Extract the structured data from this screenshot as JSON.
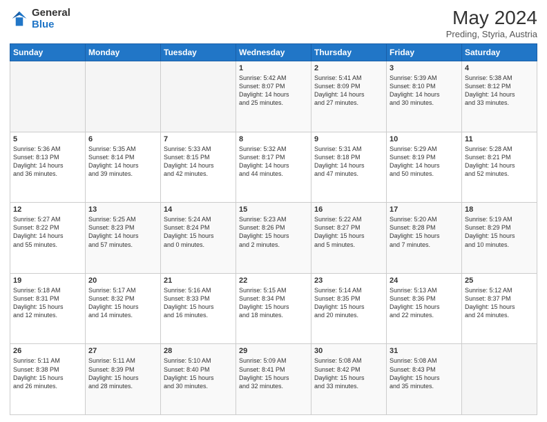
{
  "header": {
    "logo_general": "General",
    "logo_blue": "Blue",
    "month_year": "May 2024",
    "location": "Preding, Styria, Austria"
  },
  "days_of_week": [
    "Sunday",
    "Monday",
    "Tuesday",
    "Wednesday",
    "Thursday",
    "Friday",
    "Saturday"
  ],
  "weeks": [
    [
      {
        "day": "",
        "info": ""
      },
      {
        "day": "",
        "info": ""
      },
      {
        "day": "",
        "info": ""
      },
      {
        "day": "1",
        "info": "Sunrise: 5:42 AM\nSunset: 8:07 PM\nDaylight: 14 hours\nand 25 minutes."
      },
      {
        "day": "2",
        "info": "Sunrise: 5:41 AM\nSunset: 8:09 PM\nDaylight: 14 hours\nand 27 minutes."
      },
      {
        "day": "3",
        "info": "Sunrise: 5:39 AM\nSunset: 8:10 PM\nDaylight: 14 hours\nand 30 minutes."
      },
      {
        "day": "4",
        "info": "Sunrise: 5:38 AM\nSunset: 8:12 PM\nDaylight: 14 hours\nand 33 minutes."
      }
    ],
    [
      {
        "day": "5",
        "info": "Sunrise: 5:36 AM\nSunset: 8:13 PM\nDaylight: 14 hours\nand 36 minutes."
      },
      {
        "day": "6",
        "info": "Sunrise: 5:35 AM\nSunset: 8:14 PM\nDaylight: 14 hours\nand 39 minutes."
      },
      {
        "day": "7",
        "info": "Sunrise: 5:33 AM\nSunset: 8:15 PM\nDaylight: 14 hours\nand 42 minutes."
      },
      {
        "day": "8",
        "info": "Sunrise: 5:32 AM\nSunset: 8:17 PM\nDaylight: 14 hours\nand 44 minutes."
      },
      {
        "day": "9",
        "info": "Sunrise: 5:31 AM\nSunset: 8:18 PM\nDaylight: 14 hours\nand 47 minutes."
      },
      {
        "day": "10",
        "info": "Sunrise: 5:29 AM\nSunset: 8:19 PM\nDaylight: 14 hours\nand 50 minutes."
      },
      {
        "day": "11",
        "info": "Sunrise: 5:28 AM\nSunset: 8:21 PM\nDaylight: 14 hours\nand 52 minutes."
      }
    ],
    [
      {
        "day": "12",
        "info": "Sunrise: 5:27 AM\nSunset: 8:22 PM\nDaylight: 14 hours\nand 55 minutes."
      },
      {
        "day": "13",
        "info": "Sunrise: 5:25 AM\nSunset: 8:23 PM\nDaylight: 14 hours\nand 57 minutes."
      },
      {
        "day": "14",
        "info": "Sunrise: 5:24 AM\nSunset: 8:24 PM\nDaylight: 15 hours\nand 0 minutes."
      },
      {
        "day": "15",
        "info": "Sunrise: 5:23 AM\nSunset: 8:26 PM\nDaylight: 15 hours\nand 2 minutes."
      },
      {
        "day": "16",
        "info": "Sunrise: 5:22 AM\nSunset: 8:27 PM\nDaylight: 15 hours\nand 5 minutes."
      },
      {
        "day": "17",
        "info": "Sunrise: 5:20 AM\nSunset: 8:28 PM\nDaylight: 15 hours\nand 7 minutes."
      },
      {
        "day": "18",
        "info": "Sunrise: 5:19 AM\nSunset: 8:29 PM\nDaylight: 15 hours\nand 10 minutes."
      }
    ],
    [
      {
        "day": "19",
        "info": "Sunrise: 5:18 AM\nSunset: 8:31 PM\nDaylight: 15 hours\nand 12 minutes."
      },
      {
        "day": "20",
        "info": "Sunrise: 5:17 AM\nSunset: 8:32 PM\nDaylight: 15 hours\nand 14 minutes."
      },
      {
        "day": "21",
        "info": "Sunrise: 5:16 AM\nSunset: 8:33 PM\nDaylight: 15 hours\nand 16 minutes."
      },
      {
        "day": "22",
        "info": "Sunrise: 5:15 AM\nSunset: 8:34 PM\nDaylight: 15 hours\nand 18 minutes."
      },
      {
        "day": "23",
        "info": "Sunrise: 5:14 AM\nSunset: 8:35 PM\nDaylight: 15 hours\nand 20 minutes."
      },
      {
        "day": "24",
        "info": "Sunrise: 5:13 AM\nSunset: 8:36 PM\nDaylight: 15 hours\nand 22 minutes."
      },
      {
        "day": "25",
        "info": "Sunrise: 5:12 AM\nSunset: 8:37 PM\nDaylight: 15 hours\nand 24 minutes."
      }
    ],
    [
      {
        "day": "26",
        "info": "Sunrise: 5:11 AM\nSunset: 8:38 PM\nDaylight: 15 hours\nand 26 minutes."
      },
      {
        "day": "27",
        "info": "Sunrise: 5:11 AM\nSunset: 8:39 PM\nDaylight: 15 hours\nand 28 minutes."
      },
      {
        "day": "28",
        "info": "Sunrise: 5:10 AM\nSunset: 8:40 PM\nDaylight: 15 hours\nand 30 minutes."
      },
      {
        "day": "29",
        "info": "Sunrise: 5:09 AM\nSunset: 8:41 PM\nDaylight: 15 hours\nand 32 minutes."
      },
      {
        "day": "30",
        "info": "Sunrise: 5:08 AM\nSunset: 8:42 PM\nDaylight: 15 hours\nand 33 minutes."
      },
      {
        "day": "31",
        "info": "Sunrise: 5:08 AM\nSunset: 8:43 PM\nDaylight: 15 hours\nand 35 minutes."
      },
      {
        "day": "",
        "info": ""
      }
    ]
  ]
}
